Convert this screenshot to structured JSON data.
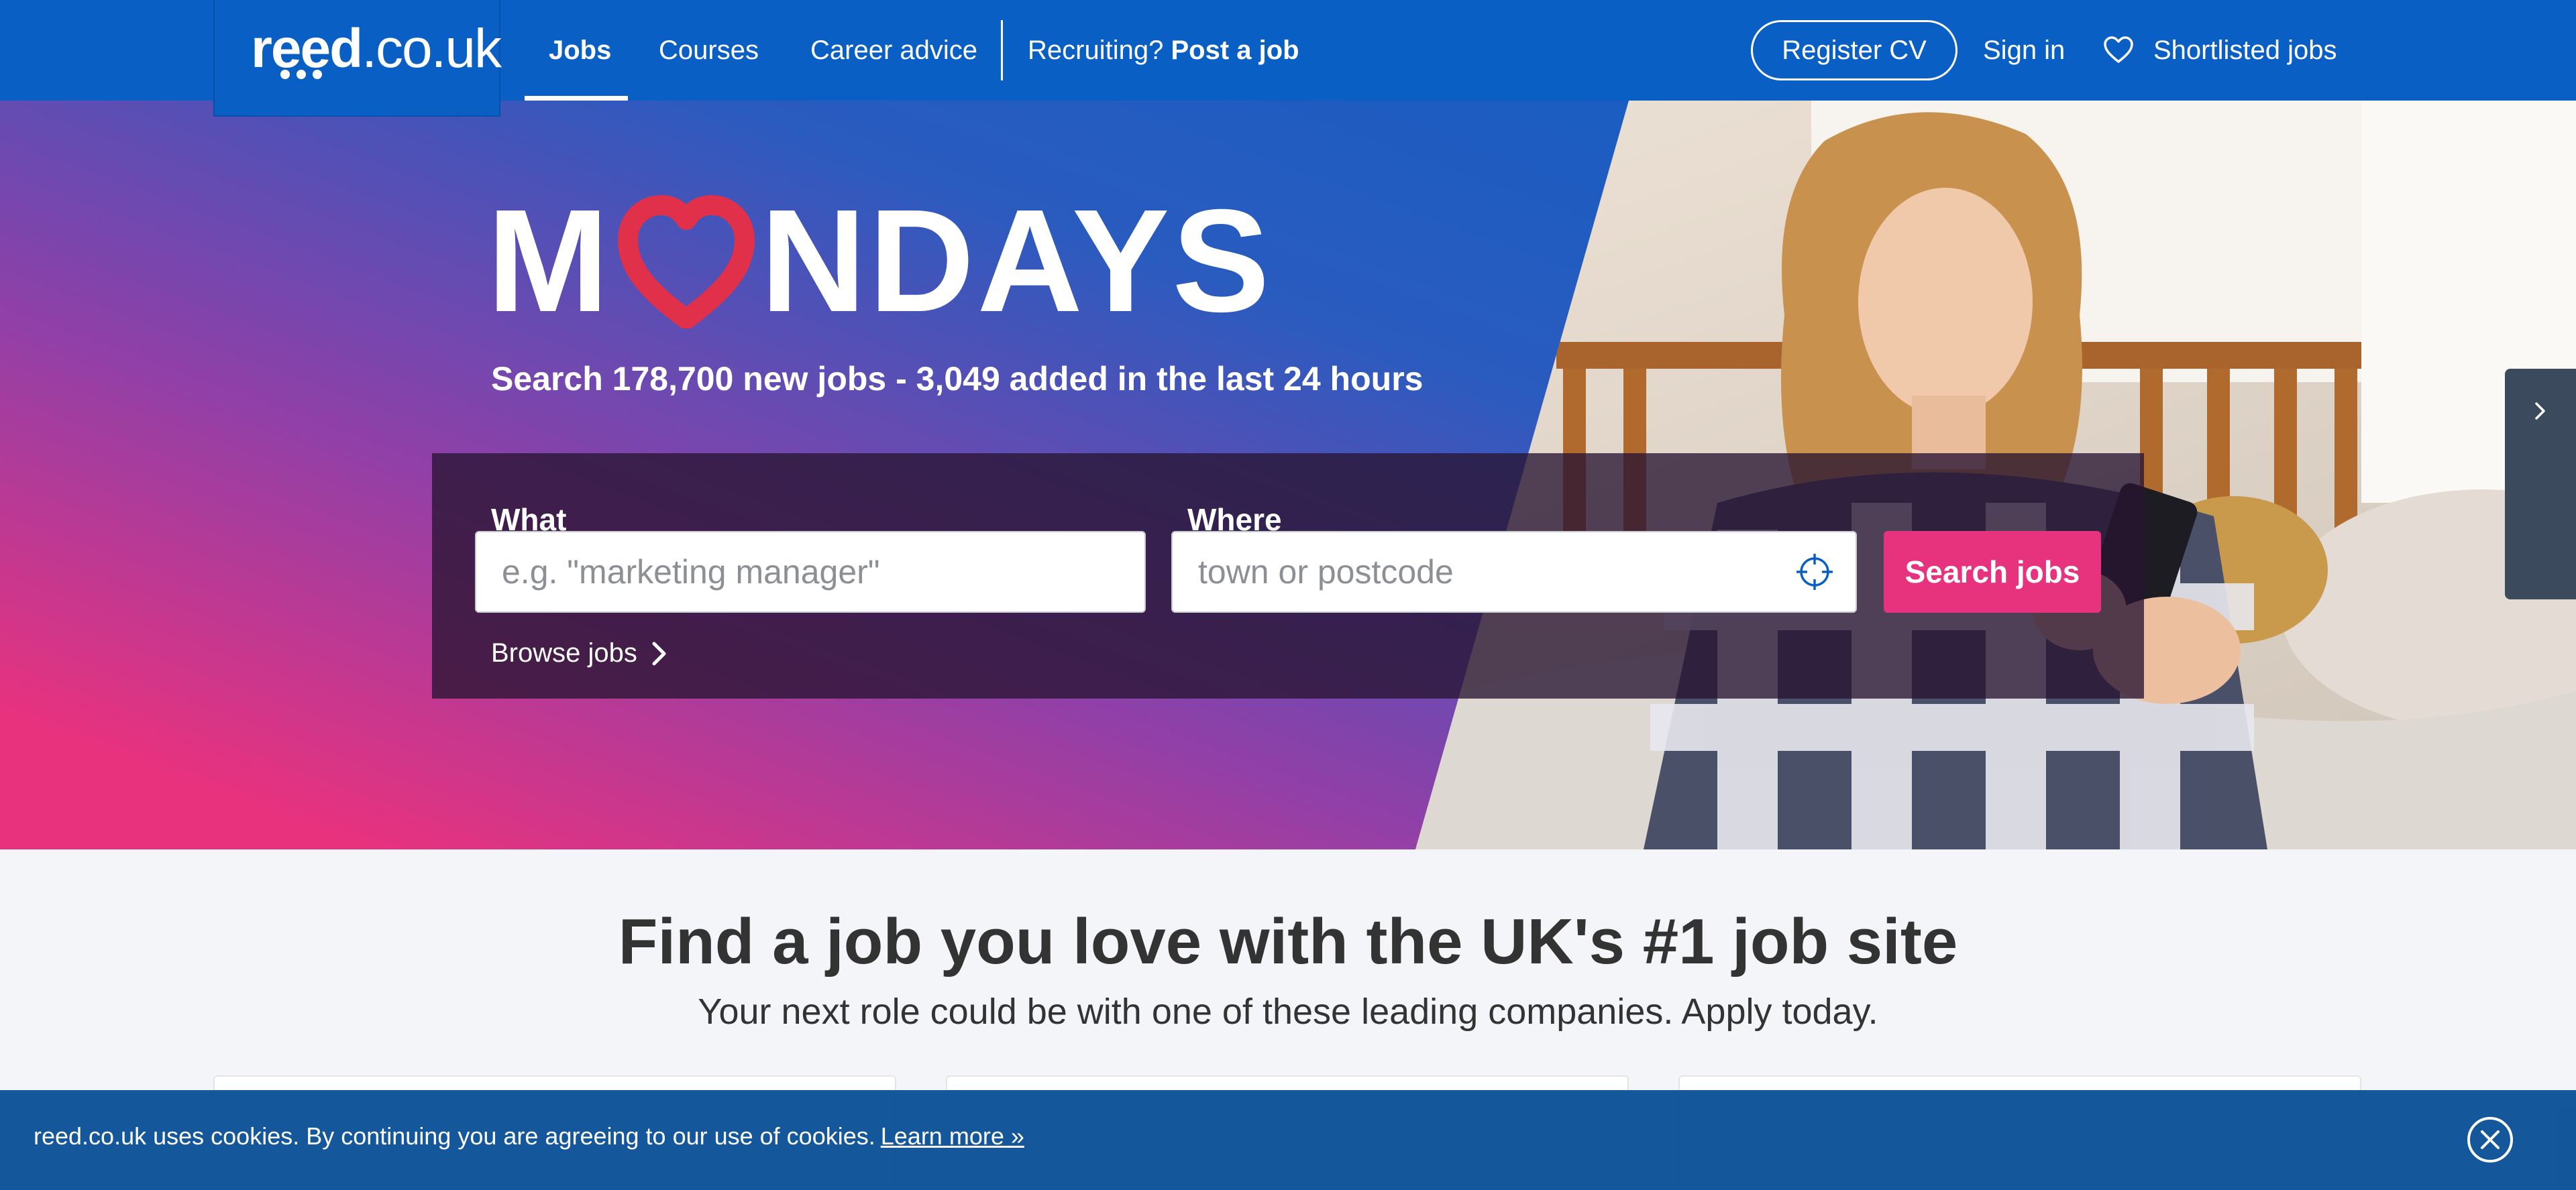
{
  "colors": {
    "brand_blue": "#0a5fc4",
    "accent_pink": "#e7327e",
    "heart_red": "#e0304a",
    "text_dark": "#333333"
  },
  "nav": {
    "logo_bold": "reed",
    "logo_light": ".co.uk",
    "jobs": "Jobs",
    "courses": "Courses",
    "career_advice": "Career advice",
    "recruiting_prefix": "Recruiting?",
    "post_a_job": "Post a job",
    "register_cv": "Register CV",
    "sign_in": "Sign in",
    "shortlisted_jobs": "Shortlisted jobs",
    "shortlist_icon": "heart-outline-icon"
  },
  "hero": {
    "banner_start": "M",
    "banner_end": "NDAYS",
    "banner_heart_icon": "heart-letter-o-icon",
    "subline": "Search 178,700 new jobs - 3,049 added in the last 24 hours",
    "what_label": "What",
    "what_placeholder": "e.g. \"marketing manager\"",
    "what_value": "",
    "where_label": "Where",
    "where_placeholder": "town or postcode",
    "where_value": "",
    "location_icon": "crosshair-icon",
    "search_button": "Search jobs",
    "browse_jobs": "Browse jobs",
    "browse_icon": "chevron-right-icon",
    "side_tab_icon": "chevron-right-icon"
  },
  "main": {
    "headline_plain": "Find a job you love with the",
    "headline_bold": "UK's #1 job site",
    "subheadline": "Your next role could be with one of these leading companies. Apply today."
  },
  "cookie": {
    "message": "reed.co.uk uses cookies. By continuing you are agreeing to our use of cookies.",
    "learn_more": "Learn more »",
    "close_icon": "close-circle-icon"
  }
}
